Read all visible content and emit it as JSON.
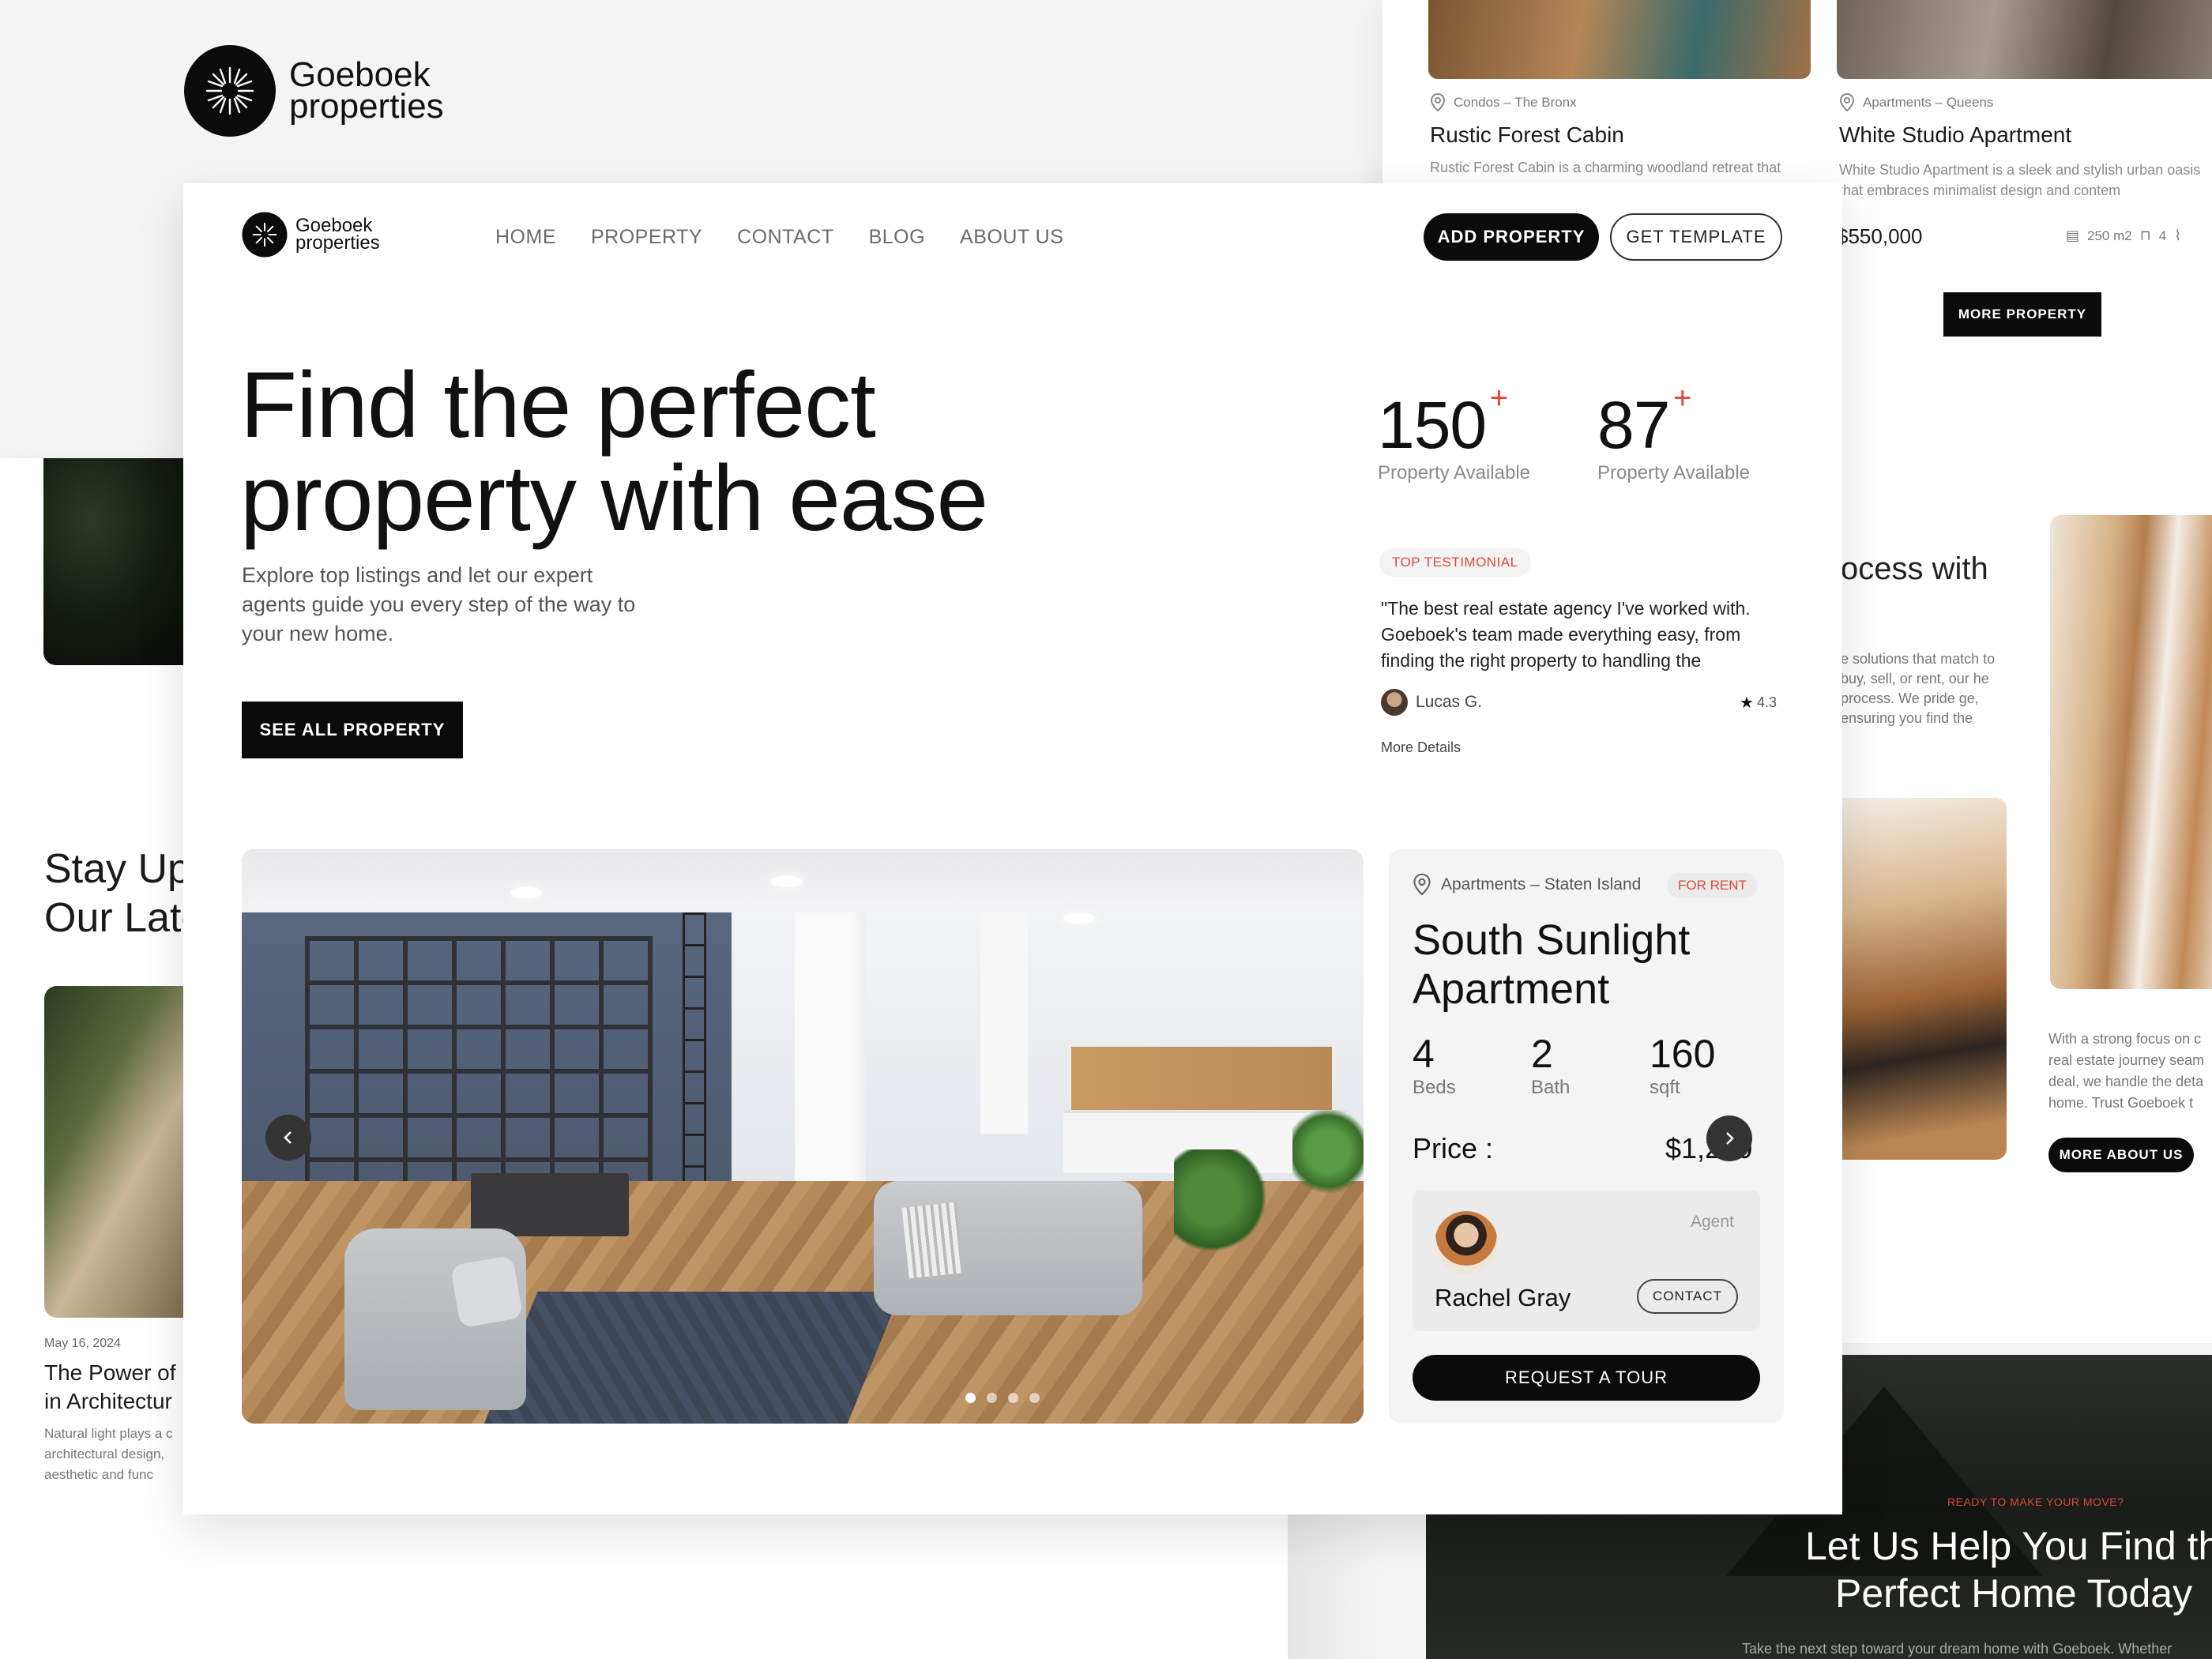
{
  "brand": {
    "line1": "Goeboek",
    "line2": "properties"
  },
  "bg_top_right": {
    "card1": {
      "location": "Condos – The Bronx",
      "title": "Rustic Forest Cabin",
      "desc": "Rustic Forest Cabin is a charming woodland retreat that"
    },
    "card2": {
      "location": "Apartments – Queens",
      "title": "White Studio Apartment",
      "desc": "White Studio Apartment is a sleek and stylish urban oasis that embraces minimalist design and contem",
      "price": "$550,000",
      "area": "250 m2",
      "beds": "4"
    },
    "more_btn": "MORE PROPERTY"
  },
  "bg_right": {
    "heading": "ocess with",
    "para": "e solutions that match to buy, sell, or rent, our he process. We pride ge, ensuring you find the",
    "about_para": "With a strong focus on c real estate journey seam deal, we handle the deta home. Trust Goeboek t",
    "about_btn": "MORE ABOUT US"
  },
  "bg_bottom_right": {
    "tag": "READY TO MAKE YOUR MOVE?",
    "heading_line1": "Let Us Help You Find th",
    "heading_line2": "Perfect Home Today",
    "sub": "Take the next step toward your dream home with Goeboek. Whether"
  },
  "bg_left": {
    "heading_line1": "Stay Up",
    "heading_line2": "Our Late",
    "date": "May 16, 2024",
    "post_title_line1": "The Power of N",
    "post_title_line2": "in Architectur",
    "post_desc": "Natural light plays a c architectural design, aesthetic and func"
  },
  "nav": {
    "items": [
      "HOME",
      "PROPERTY",
      "CONTACT",
      "BLOG",
      "ABOUT US"
    ],
    "add_btn": "ADD PROPERTY",
    "template_btn": "GET TEMPLATE"
  },
  "hero": {
    "title_line1": "Find the perfect",
    "title_line2": "property with ease",
    "subtitle": "Explore top listings and let our expert agents guide you every step of the way to your new home.",
    "cta": "SEE ALL PROPERTY"
  },
  "stats": [
    {
      "value": "150",
      "plus": "+",
      "label": "Property Available"
    },
    {
      "value": "87",
      "plus": "+",
      "label": "Property Available"
    }
  ],
  "testimonial": {
    "badge": "TOP TESTIMONIAL",
    "quote": "\"The best real estate agency I've worked with. Goeboek's team made everything easy, from finding the right property to handling the",
    "author": "Lucas G.",
    "rating": "4.3",
    "more": "More Details"
  },
  "listing": {
    "location": "Apartments – Staten Island",
    "status": "FOR RENT",
    "title_line1": "South Sunlight",
    "title_line2": "Apartment",
    "specs": [
      {
        "value": "4",
        "label": "Beds"
      },
      {
        "value": "2",
        "label": "Bath"
      },
      {
        "value": "160",
        "label": "sqft"
      }
    ],
    "price_label": "Price :",
    "price": "$1,200",
    "agent_label": "Agent",
    "agent_name": "Rachel Gray",
    "contact_btn": "CONTACT",
    "tour_btn": "REQUEST A TOUR",
    "carousel_dots": 4,
    "active_dot": 1
  },
  "colors": {
    "accent": "#e0483a",
    "dark": "#0b0b0b",
    "card_bg": "#f4f4f4"
  }
}
